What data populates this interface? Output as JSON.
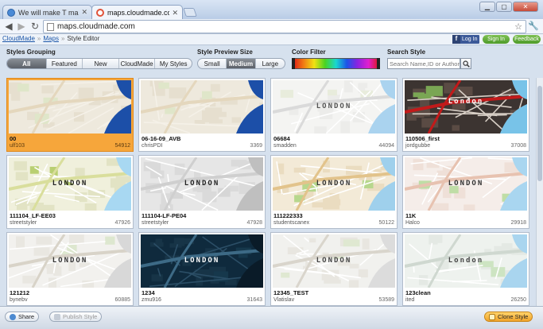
{
  "browser": {
    "tabs": [
      {
        "title": "We will make T map be n",
        "active": false
      },
      {
        "title": "maps.cloudmade.com",
        "active": true
      }
    ],
    "url": "maps.cloudmade.com"
  },
  "breadcrumb": {
    "items": [
      "CloudMade",
      "Maps",
      "Style Editor"
    ]
  },
  "top_buttons": {
    "facebook_login": "Log In",
    "sign_in": "Sign In",
    "feedback": "Feedback"
  },
  "controls": {
    "grouping_label": "Styles Grouping",
    "grouping_options": [
      "All",
      "Featured",
      "New",
      "CloudMade",
      "My Styles"
    ],
    "grouping_selected": "All",
    "preview_size_label": "Style Preview Size",
    "preview_sizes": [
      "Small",
      "Medium",
      "Large"
    ],
    "preview_selected": "Medium",
    "color_filter_label": "Color Filter",
    "search_label": "Search Style",
    "search_placeholder": "Search Name,ID or Author"
  },
  "styles": [
    {
      "name": "00",
      "author": "ulf103",
      "id": "54912",
      "selected": true,
      "theme": "beige",
      "label": ""
    },
    {
      "name": "06-16-09_AVB",
      "author": "chrisPDI",
      "id": "3369",
      "selected": false,
      "theme": "beige",
      "label": ""
    },
    {
      "name": "06684",
      "author": "smadden",
      "id": "44094",
      "selected": false,
      "theme": "light",
      "label": "LONDON"
    },
    {
      "name": "110506_first",
      "author": "jordgubbe",
      "id": "37008",
      "selected": false,
      "theme": "red",
      "label": "London"
    },
    {
      "name": "111104_LF-EE03",
      "author": "streetstyler",
      "id": "47926",
      "selected": false,
      "theme": "olive",
      "label": "LONDON"
    },
    {
      "name": "111104-LF-PE04",
      "author": "streetstyler",
      "id": "47928",
      "selected": false,
      "theme": "gray",
      "label": "LONDON"
    },
    {
      "name": "111222333",
      "author": "studentscanex",
      "id": "50122",
      "selected": false,
      "theme": "tan",
      "label": "LONDON"
    },
    {
      "name": "11K",
      "author": "Halco",
      "id": "29918",
      "selected": false,
      "theme": "pink",
      "label": "LONDON"
    },
    {
      "name": "121212",
      "author": "bynebv",
      "id": "60885",
      "selected": false,
      "theme": "plain",
      "label": "LONDON"
    },
    {
      "name": "1234",
      "author": "zmu916",
      "id": "31643",
      "selected": false,
      "theme": "dark",
      "label": "LONDON"
    },
    {
      "name": "12345_TEST",
      "author": "Vlatislav",
      "id": "53589",
      "selected": false,
      "theme": "light2",
      "label": "LONDON"
    },
    {
      "name": "123clean",
      "author": "ited",
      "id": "26250",
      "selected": false,
      "theme": "clean",
      "label": "London"
    }
  ],
  "footer": {
    "share": "Share",
    "publish": "Publish Style",
    "clone": "Clone Style"
  },
  "colors": {
    "selected_card": "#f6a63b",
    "water": "#a8d4f0",
    "accent_green": "#5aa832"
  }
}
